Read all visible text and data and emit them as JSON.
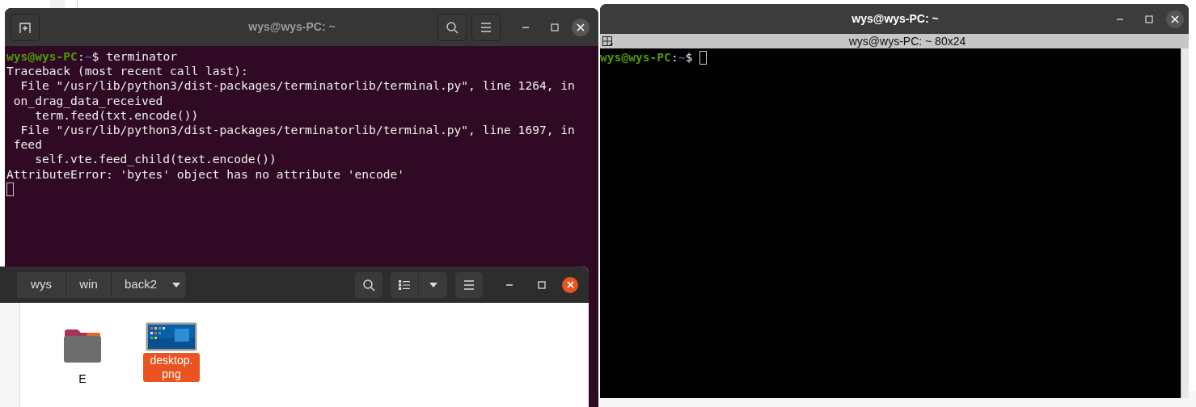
{
  "terminal_window": {
    "title": "wys@wys-PC: ~",
    "lines": [
      {
        "kind": "prompt",
        "user": "wys@wys-PC",
        "colon": ":",
        "path": "~",
        "symbol": "$",
        "command": "terminator"
      },
      {
        "kind": "output",
        "text": "Traceback (most recent call last):"
      },
      {
        "kind": "output",
        "text": "  File \"/usr/lib/python3/dist-packages/terminatorlib/terminal.py\", line 1264, in"
      },
      {
        "kind": "output",
        "text": " on_drag_data_received"
      },
      {
        "kind": "output",
        "text": "    term.feed(txt.encode())"
      },
      {
        "kind": "output",
        "text": "  File \"/usr/lib/python3/dist-packages/terminatorlib/terminal.py\", line 1697, in"
      },
      {
        "kind": "output",
        "text": " feed"
      },
      {
        "kind": "output",
        "text": "    self.vte.feed_child(text.encode())"
      },
      {
        "kind": "output",
        "text": "AttributeError: 'bytes' object has no attribute 'encode'"
      },
      {
        "kind": "cursor"
      }
    ]
  },
  "terminator_window": {
    "title": "wys@wys-PC: ~",
    "tab_title": "wys@wys-PC: ~ 80x24",
    "lines": [
      {
        "kind": "prompt",
        "user": "wys@wys-PC",
        "colon": ":",
        "path": "~",
        "symbol": "$"
      }
    ]
  },
  "file_manager": {
    "path": [
      "wys",
      "win",
      "back2"
    ],
    "items": [
      {
        "kind": "folder",
        "label": "E",
        "selected": false
      },
      {
        "label": "desktop.png",
        "selected": true
      }
    ]
  }
}
